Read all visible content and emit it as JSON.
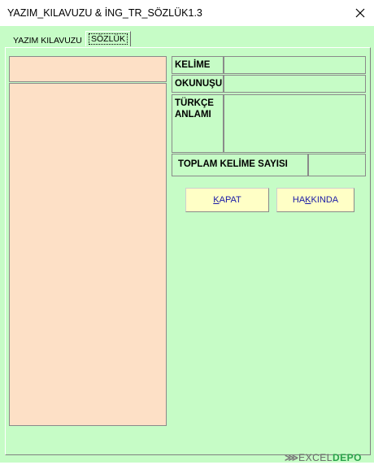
{
  "window": {
    "title": "YAZIM_KILAVUZU & İNG_TR_SÖZLÜK1.3"
  },
  "tabs": [
    {
      "label": "YAZIM KILAVUZU"
    },
    {
      "label": "SÖZLÜK"
    }
  ],
  "fields": {
    "kelime_label": "KELİME",
    "okunusu_label": "OKUNUŞU",
    "turkce_label_line1": "TÜRKÇE",
    "turkce_label_line2": "ANLAMI",
    "toplam_label": "TOPLAM KELİME SAYISI"
  },
  "buttons": {
    "kapat_accel": "K",
    "kapat_rest": "APAT",
    "hakkinda_pre": "HA",
    "hakkinda_accel": "K",
    "hakkinda_rest": "KINDA"
  },
  "watermark": {
    "part1": "EXCEL",
    "part2": "DEPO"
  },
  "colors": {
    "background": "#c6fcc6",
    "peach": "#fde0c6",
    "button": "#ffffc6",
    "button_text": "#1a1aa6"
  }
}
